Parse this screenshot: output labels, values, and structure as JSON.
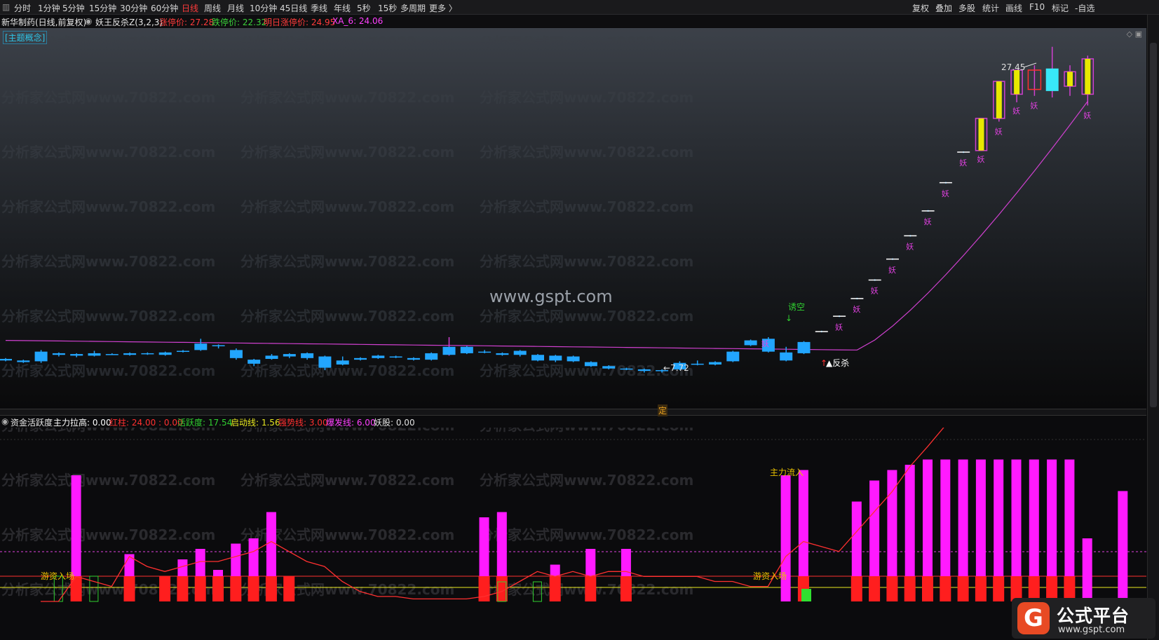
{
  "toolbar": {
    "periods": [
      "分时",
      "1分钟",
      "5分钟",
      "15分钟",
      "30分钟",
      "60分钟",
      "日线",
      "周线",
      "月线",
      "10分钟",
      "45日线",
      "季线",
      "年线",
      "5秒",
      "15秒",
      "多周期",
      "更多 〉"
    ],
    "active_period": "日线",
    "tools": [
      "复权",
      "叠加",
      "多股",
      "统计",
      "画线",
      "F10",
      "标记",
      "-自选"
    ]
  },
  "title": {
    "stock": "新华制药(日线,前复权)",
    "indicator": "妖王反杀Z(3,2,3)",
    "limit_up": "涨停价: 27.28",
    "limit_down": "跌停价: 22.32",
    "next_limit_up": "明日涨停价: 24.95",
    "xa6": "XA_6: 24.06"
  },
  "concept_tag": "[主题概念]",
  "watermark_site": "www.gspt.com",
  "watermark_tile": "分析家公式网www.70822.com",
  "annotations": {
    "high_price": "27.45",
    "low_price": "7.72",
    "lure_short": "诱空",
    "counter_kill": "反杀",
    "yao": "妖",
    "ding": "定",
    "main_inflow": "主力流入",
    "hot_money": "游资入场"
  },
  "indicator_header": {
    "name": "资金活跃度",
    "items": [
      {
        "text": "主力拉高: 0.00",
        "color": "#ffffff"
      },
      {
        "text": "红柱: 24.00 : 0.00",
        "color": "#ff3030"
      },
      {
        "text": "活跃度: 17.54",
        "color": "#30d030"
      },
      {
        "text": "启动线: 1.56",
        "color": "#e8e820"
      },
      {
        "text": "强势线: 3.00",
        "color": "#ff3030"
      },
      {
        "text": "爆发线: 6.00",
        "color": "#ff40ff"
      },
      {
        "text": "妖股: 0.00",
        "color": "#e0e0e0"
      }
    ]
  },
  "brand": {
    "logo": "G",
    "name": "公式平台",
    "url": "www.gspt.com"
  },
  "chart_data": [
    {
      "type": "candlestick",
      "title": "新华制药(日线,前复权)",
      "series": [
        {
          "name": "K线",
          "values": [
            {
              "o": 8.05,
              "c": 7.95,
              "h": 8.1,
              "l": 7.9
            },
            {
              "o": 7.95,
              "c": 7.85,
              "h": 8.0,
              "l": 7.8
            },
            {
              "o": 7.9,
              "c": 8.5,
              "h": 8.6,
              "l": 7.8
            },
            {
              "o": 8.4,
              "c": 8.3,
              "h": 8.45,
              "l": 8.2
            },
            {
              "o": 8.35,
              "c": 8.25,
              "h": 8.4,
              "l": 8.15
            },
            {
              "o": 8.25,
              "c": 8.4,
              "h": 8.55,
              "l": 8.2
            },
            {
              "o": 8.35,
              "c": 8.35,
              "h": 8.4,
              "l": 8.3
            },
            {
              "o": 8.3,
              "c": 8.4,
              "h": 8.45,
              "l": 8.25
            },
            {
              "o": 8.4,
              "c": 8.35,
              "h": 8.45,
              "l": 8.3
            },
            {
              "o": 8.3,
              "c": 8.45,
              "h": 8.5,
              "l": 8.25
            },
            {
              "o": 8.5,
              "c": 8.55,
              "h": 8.6,
              "l": 8.45
            },
            {
              "o": 8.6,
              "c": 9.0,
              "h": 9.3,
              "l": 8.55
            },
            {
              "o": 8.9,
              "c": 8.9,
              "h": 8.95,
              "l": 8.7
            },
            {
              "o": 8.6,
              "c": 8.1,
              "h": 8.7,
              "l": 8.0
            },
            {
              "o": 8.0,
              "c": 7.75,
              "h": 8.05,
              "l": 7.6
            },
            {
              "o": 8.05,
              "c": 8.25,
              "h": 8.35,
              "l": 8.0
            },
            {
              "o": 8.2,
              "c": 8.35,
              "h": 8.4,
              "l": 8.1
            },
            {
              "o": 8.4,
              "c": 8.1,
              "h": 8.45,
              "l": 8.0
            },
            {
              "o": 8.2,
              "c": 7.5,
              "h": 8.25,
              "l": 7.35
            },
            {
              "o": 7.7,
              "c": 7.95,
              "h": 8.2,
              "l": 7.65
            },
            {
              "o": 8.0,
              "c": 8.1,
              "h": 8.15,
              "l": 7.95
            },
            {
              "o": 8.1,
              "c": 8.25,
              "h": 8.3,
              "l": 8.05
            },
            {
              "o": 8.2,
              "c": 8.15,
              "h": 8.25,
              "l": 8.1
            },
            {
              "o": 8.1,
              "c": 8.0,
              "h": 8.15,
              "l": 7.95
            },
            {
              "o": 8.0,
              "c": 8.4,
              "h": 8.45,
              "l": 7.95
            },
            {
              "o": 8.3,
              "c": 8.8,
              "h": 9.4,
              "l": 8.25
            },
            {
              "o": 8.4,
              "c": 8.8,
              "h": 8.85,
              "l": 8.35
            },
            {
              "o": 8.5,
              "c": 8.45,
              "h": 8.6,
              "l": 8.4
            },
            {
              "o": 8.4,
              "c": 8.3,
              "h": 8.45,
              "l": 8.25
            },
            {
              "o": 8.55,
              "c": 8.3,
              "h": 8.6,
              "l": 8.2
            },
            {
              "o": 8.3,
              "c": 7.95,
              "h": 8.35,
              "l": 7.9
            },
            {
              "o": 8.25,
              "c": 7.95,
              "h": 8.3,
              "l": 7.85
            },
            {
              "o": 8.2,
              "c": 7.9,
              "h": 8.25,
              "l": 7.85
            },
            {
              "o": 7.85,
              "c": 7.6,
              "h": 7.9,
              "l": 7.55
            },
            {
              "o": 7.6,
              "c": 7.45,
              "h": 7.65,
              "l": 7.4
            },
            {
              "o": 7.45,
              "c": 7.4,
              "h": 7.5,
              "l": 7.35
            },
            {
              "o": 7.4,
              "c": 7.3,
              "h": 7.45,
              "l": 7.2
            },
            {
              "o": 7.35,
              "c": 7.35,
              "h": 7.4,
              "l": 7.2
            },
            {
              "o": 7.4,
              "c": 7.8,
              "h": 7.9,
              "l": 7.35
            },
            {
              "o": 7.75,
              "c": 7.7,
              "h": 7.95,
              "l": 7.65
            },
            {
              "o": 7.7,
              "c": 7.85,
              "h": 7.9,
              "l": 7.65
            },
            {
              "o": 7.9,
              "c": 8.5,
              "h": 8.55,
              "l": 7.85
            },
            {
              "o": 8.9,
              "c": 9.2,
              "h": 9.25,
              "l": 8.85
            },
            {
              "o": 8.5,
              "c": 9.3,
              "h": 9.4,
              "l": 8.45
            },
            {
              "o": 7.95,
              "c": 8.45,
              "h": 8.8,
              "l": 7.9
            },
            {
              "o": 8.4,
              "c": 9.1,
              "h": 9.15,
              "l": 8.35
            },
            {
              "o": 9.75,
              "c": 9.75,
              "h": 9.8,
              "l": 9.7
            },
            {
              "o": 10.7,
              "c": 10.7,
              "h": 10.75,
              "l": 10.65
            },
            {
              "o": 11.8,
              "c": 11.8,
              "h": 11.85,
              "l": 11.75
            },
            {
              "o": 12.95,
              "c": 12.95,
              "h": 13.0,
              "l": 12.9
            },
            {
              "o": 14.25,
              "c": 14.25,
              "h": 14.3,
              "l": 14.2
            },
            {
              "o": 15.7,
              "c": 15.7,
              "h": 15.75,
              "l": 15.65
            },
            {
              "o": 17.25,
              "c": 17.25,
              "h": 17.3,
              "l": 17.2
            },
            {
              "o": 19.0,
              "c": 19.0,
              "h": 19.05,
              "l": 18.95
            },
            {
              "o": 20.9,
              "c": 20.9,
              "h": 20.95,
              "l": 20.85
            },
            {
              "o": 21.0,
              "c": 23.0,
              "h": 23.0,
              "l": 21.0
            },
            {
              "o": 23.0,
              "c": 25.3,
              "h": 25.3,
              "l": 22.8
            },
            {
              "o": 24.5,
              "c": 26.0,
              "h": 26.0,
              "l": 24.0
            },
            {
              "o": 26.0,
              "c": 24.8,
              "h": 26.3,
              "l": 24.4
            },
            {
              "o": 26.1,
              "c": 24.7,
              "h": 27.45,
              "l": 24.3
            },
            {
              "o": 25.0,
              "c": 25.9,
              "h": 26.3,
              "l": 24.4
            },
            {
              "o": 24.5,
              "c": 26.7,
              "h": 26.9,
              "l": 23.8
            }
          ]
        },
        {
          "name": "XA_6",
          "values": [
            9.2,
            9.19,
            9.18,
            9.17,
            9.15,
            9.12,
            9.1,
            9.08,
            9.07,
            9.06,
            9.05,
            9.04,
            9.03,
            9.02,
            9.01,
            9.0,
            8.95,
            8.9,
            8.8,
            8.7,
            8.6,
            8.55,
            8.5,
            8.8,
            10.2,
            11.5,
            12.9,
            14.3,
            15.8,
            17.3,
            18.8,
            20.2,
            21.5,
            22.5,
            23.3,
            24.06
          ]
        }
      ],
      "annotations": [
        "27.45",
        "7.72",
        "诱空",
        "反杀",
        "妖",
        "定"
      ]
    },
    {
      "type": "bar",
      "title": "资金活跃度",
      "series": [
        {
          "name": "活跃度",
          "values": [
            0,
            0,
            24,
            0,
            0,
            9,
            0,
            0,
            8,
            10,
            6,
            11,
            12,
            17,
            0,
            0,
            0,
            0,
            0,
            0,
            0,
            0,
            0,
            0,
            0,
            16,
            17,
            0,
            0,
            7,
            0,
            10,
            0,
            10,
            0,
            0,
            0,
            0,
            0,
            0,
            0,
            0,
            24,
            25,
            0,
            0,
            19,
            23,
            25,
            26,
            27,
            27,
            27,
            27,
            27,
            27,
            27,
            27,
            27,
            12,
            0,
            21
          ]
        },
        {
          "name": "红柱",
          "values": [
            0,
            0,
            4,
            0,
            0,
            4,
            0,
            4,
            4,
            4,
            4,
            4,
            4,
            4,
            4,
            0,
            0,
            0,
            0,
            0,
            0,
            0,
            0,
            0,
            0,
            4,
            4,
            0,
            0,
            4,
            0,
            4,
            0,
            4,
            0,
            0,
            0,
            0,
            0,
            0,
            0,
            0,
            0,
            4,
            0,
            0,
            4,
            4,
            4,
            4,
            4,
            4,
            4,
            4,
            4,
            4,
            4,
            4,
            4,
            0,
            0,
            0
          ]
        },
        {
          "name": "主力拉高",
          "values": [
            0,
            0,
            0,
            0,
            4,
            0,
            0,
            0,
            0,
            0,
            0,
            0,
            0,
            0,
            0,
            0,
            0,
            0,
            0,
            0,
            0,
            0,
            0,
            0,
            0,
            0,
            0,
            0,
            3,
            0,
            3,
            0,
            0,
            0,
            0,
            0,
            0,
            0,
            0,
            0,
            0,
            0,
            0,
            0,
            0,
            1,
            0,
            0,
            0,
            0,
            0,
            0,
            0,
            0,
            0,
            0,
            0,
            0,
            0,
            0,
            0,
            0
          ]
        }
      ],
      "lines": {
        "启动线": 1.56,
        "强势线": 3.0,
        "爆发线": 6.0
      },
      "annotations": [
        "主力流入",
        "游资入场"
      ]
    }
  ]
}
